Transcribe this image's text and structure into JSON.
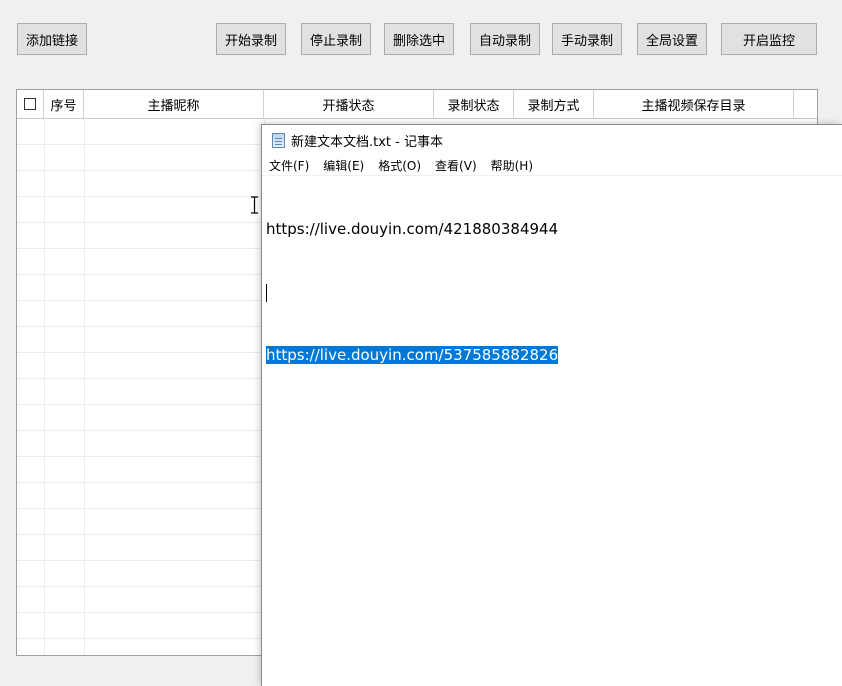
{
  "toolbar": {
    "add_link": "添加链接",
    "start_record": "开始录制",
    "stop_record": "停止录制",
    "delete_selected": "删除选中",
    "auto_record": "自动录制",
    "manual_record": "手动录制",
    "global_settings": "全局设置",
    "start_monitor": "开启监控"
  },
  "table": {
    "columns": [
      "序号",
      "主播昵称",
      "开播状态",
      "录制状态",
      "录制方式",
      "主播视频保存目录"
    ]
  },
  "notepad": {
    "title": "新建文本文档.txt - 记事本",
    "menu": [
      "文件(F)",
      "编辑(E)",
      "格式(O)",
      "查看(V)",
      "帮助(H)"
    ],
    "lines": [
      "https://live.douyin.com/421880384944",
      "",
      "https://live.douyin.com/537585882826"
    ]
  }
}
